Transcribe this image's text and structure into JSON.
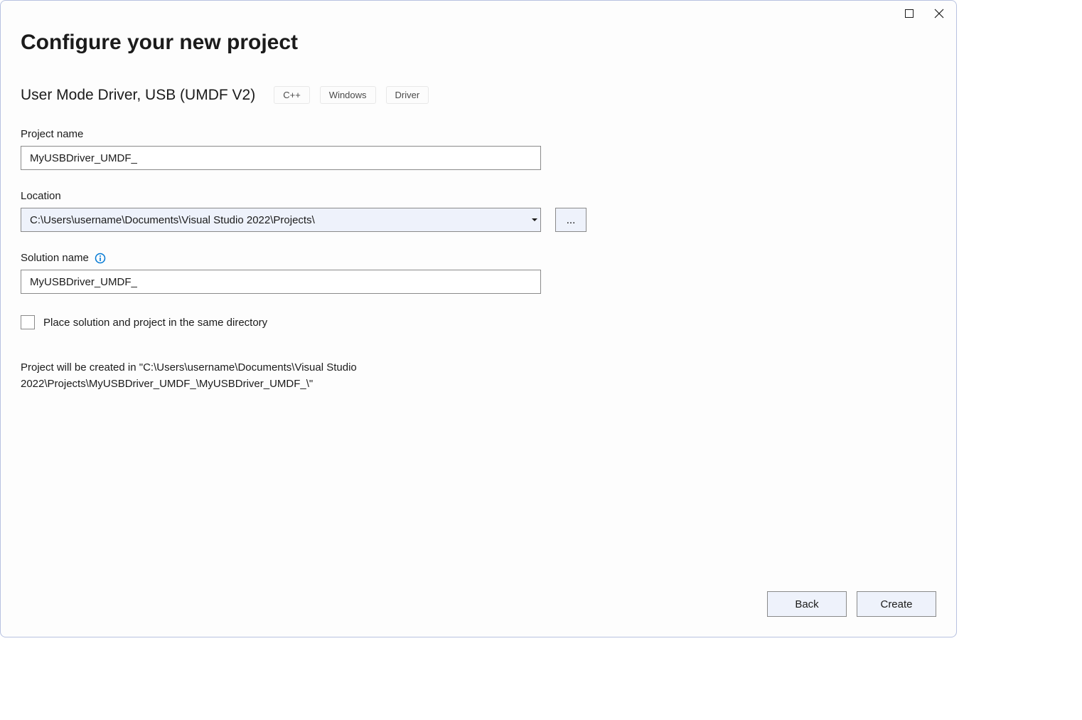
{
  "header": {
    "title": "Configure your new project"
  },
  "template": {
    "name": "User Mode Driver, USB (UMDF V2)",
    "tags": [
      "C++",
      "Windows",
      "Driver"
    ]
  },
  "fields": {
    "project_name": {
      "label": "Project name",
      "value": "MyUSBDriver_UMDF_"
    },
    "location": {
      "label": "Location",
      "value": "C:\\Users\\username\\Documents\\Visual Studio 2022\\Projects\\",
      "browse_label": "..."
    },
    "solution_name": {
      "label": "Solution name",
      "value": "MyUSBDriver_UMDF_"
    },
    "same_dir_checkbox": {
      "label": "Place solution and project in the same directory",
      "checked": false
    }
  },
  "path_info": "Project will be created in \"C:\\Users\\username\\Documents\\Visual Studio 2022\\Projects\\MyUSBDriver_UMDF_\\MyUSBDriver_UMDF_\\\"",
  "footer": {
    "back": "Back",
    "create": "Create"
  }
}
